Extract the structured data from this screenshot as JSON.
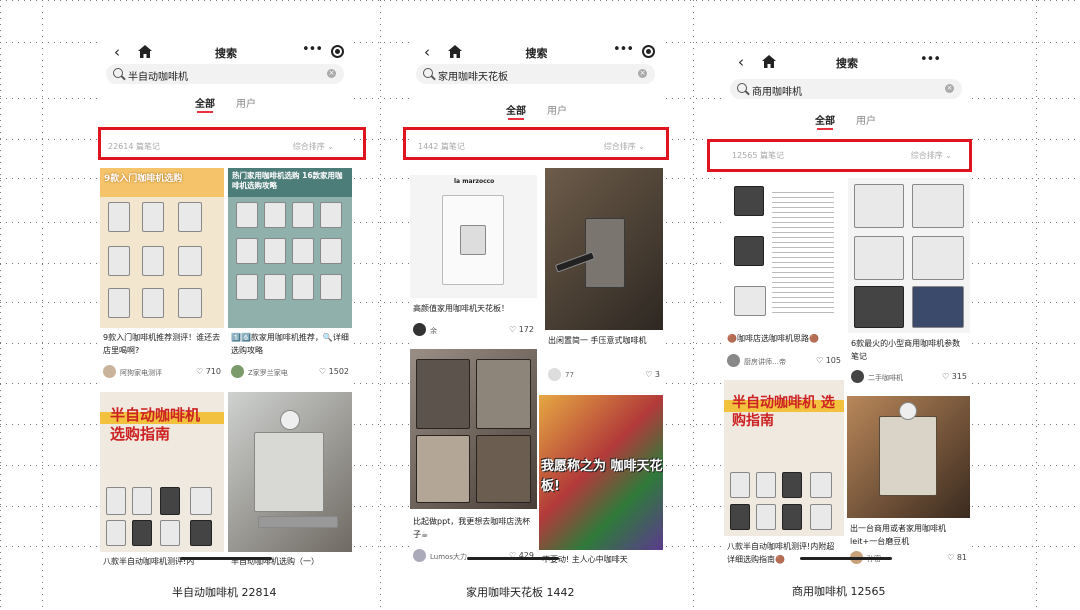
{
  "topbar": {
    "title": "搜索"
  },
  "panels": [
    {
      "query": "半自动咖啡机",
      "tab_all": "全部",
      "tab_user": "用户",
      "count": "22614 篇笔记",
      "sort": "综合排序 ⌄",
      "caption": "半自动咖啡机 22814",
      "cards": [
        {
          "banner": "9款入门咖啡机选购",
          "caption": "9款入门咖啡机推荐测评！谁还去店里喝啊?",
          "author": "阿狗家电测评",
          "likes": "710"
        },
        {
          "banner": "热门家用咖啡机选购 16款家用咖啡机选购攻略",
          "caption": "1️⃣6️⃣款家用咖啡机推荐，🔍详细选购攻略",
          "author": "Z家罗兰家电",
          "likes": "1502"
        },
        {
          "banner": "半自动咖啡机 选购指南",
          "caption": "八款半自动咖啡机测评!内",
          "author": "",
          "likes": ""
        },
        {
          "banner": "",
          "caption": "半自动咖啡机选购（一）",
          "author": "",
          "likes": ""
        }
      ]
    },
    {
      "query": "家用咖啡天花板",
      "tab_all": "全部",
      "tab_user": "用户",
      "count": "1442 篇笔记",
      "sort": "综合排序 ⌄",
      "caption": "家用咖啡天花板 1442",
      "cards": [
        {
          "banner": "la marzocco",
          "caption": "高颜值家用咖啡机天花板！",
          "author": "余",
          "likes": "172"
        },
        {
          "banner": "",
          "caption": "出闲置简一 手压意式咖啡机",
          "author": "77",
          "likes": "3"
        },
        {
          "banner": "",
          "caption": "比起做ppt，我更想去咖啡店洗杯子☕",
          "author": "Lumos大力",
          "likes": "429"
        },
        {
          "banner": "我愿称之为 咖啡天花板!",
          "caption": "不要动! 主人心中咖啡天",
          "author": "",
          "likes": ""
        }
      ]
    },
    {
      "query": "商用咖啡机",
      "tab_all": "全部",
      "tab_user": "用户",
      "count": "12565 篇笔记",
      "sort": "综合排序 ⌄",
      "caption": "商用咖啡机 12565",
      "cards": [
        {
          "banner": "",
          "caption": "🟤咖啡店选咖啡机思路🟤",
          "author": "厨房讲师…帝",
          "likes": "105"
        },
        {
          "banner": "",
          "caption": "6款最火的小型商用咖啡机参数笔记",
          "author": "二手咖啡机",
          "likes": "315"
        },
        {
          "banner": "半自动咖啡机 选购指南",
          "caption": "八款半自动咖啡机测评!内附超详细选购指南🟤",
          "author": "",
          "likes": ""
        },
        {
          "banner": "",
          "caption": "出一台商用或者家用咖啡机 leit+一台磨豆机",
          "author": "孙密",
          "likes": "81"
        }
      ]
    }
  ],
  "colors": {
    "highlight": "#e0141e",
    "accent": "#e8313f"
  }
}
